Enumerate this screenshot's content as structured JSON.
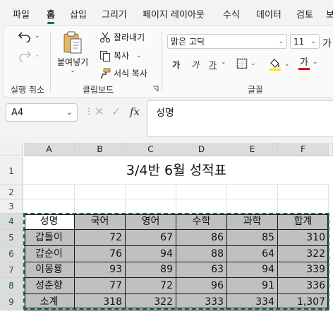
{
  "menu": {
    "tabs": [
      "파일",
      "홈",
      "삽입",
      "그리기",
      "페이지 레이아웃",
      "수식",
      "데이터",
      "검토",
      "보"
    ],
    "active_tab": "홈"
  },
  "ribbon": {
    "undo_group": {
      "label": "실행 취소"
    },
    "clipboard": {
      "label": "클립보드",
      "paste_label": "붙여넣기",
      "cut_label": "잘라내기",
      "copy_label": "복사",
      "format_painter_label": "서식 복사"
    },
    "font": {
      "label": "글꼴",
      "font_name": "맑은 고딕",
      "font_size": "11",
      "bold_glyph": "가",
      "italic_glyph": "가",
      "underline_glyph": "가",
      "font_color_glyph": "가",
      "highlight_color": "#ffe600",
      "font_color": "#e00000"
    }
  },
  "formula_bar": {
    "name_box": "A4",
    "fx_label": "fx",
    "formula": "성명"
  },
  "sheet": {
    "columns": [
      "A",
      "B",
      "C",
      "D",
      "E",
      "F"
    ],
    "rows": [
      "1",
      "2",
      "3",
      "4",
      "5",
      "6",
      "7",
      "8",
      "9"
    ],
    "title": "3/4반 6월 성적표",
    "headers": [
      "성명",
      "국어",
      "영어",
      "수학",
      "과학",
      "합계"
    ],
    "data": [
      [
        "갑돌이",
        "72",
        "67",
        "86",
        "85",
        "310"
      ],
      [
        "갑순이",
        "76",
        "94",
        "88",
        "64",
        "322"
      ],
      [
        "이몽룡",
        "93",
        "89",
        "63",
        "94",
        "339"
      ],
      [
        "성춘향",
        "77",
        "72",
        "96",
        "91",
        "336"
      ],
      [
        "소계",
        "318",
        "322",
        "333",
        "334",
        "1,307"
      ]
    ],
    "accent_color": "#217346",
    "fill_color": "#c0c0c0"
  }
}
